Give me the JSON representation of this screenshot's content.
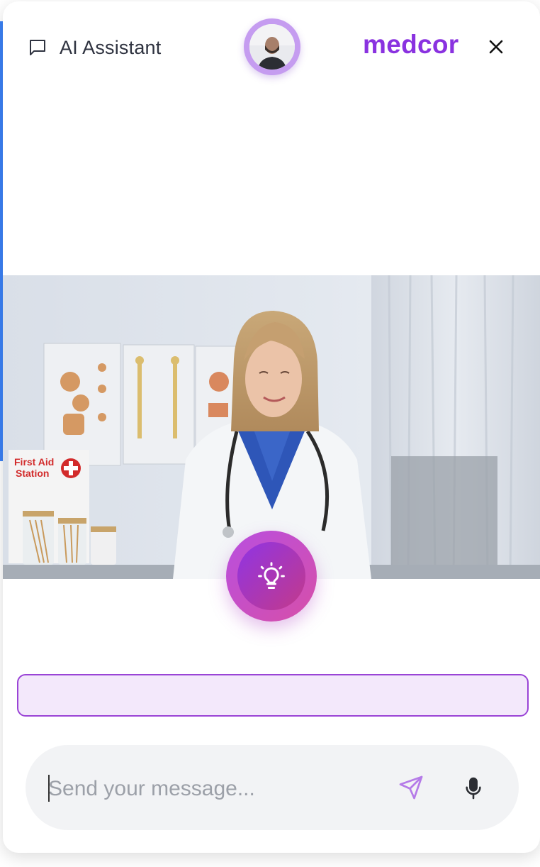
{
  "header": {
    "assistant_label": "AI Assistant",
    "brand": "medcor"
  },
  "video": {
    "poster_text": "First Aid\nStation"
  },
  "suggestion": {
    "text": ""
  },
  "composer": {
    "placeholder": "Send your message..."
  },
  "colors": {
    "brand": "#8a32e0",
    "accent_border": "#9a44d6",
    "suggestion_bg": "#f3e8fb",
    "hint_gradient_start": "#8f34e4",
    "hint_gradient_end": "#c33a8a",
    "composer_bg": "#f2f3f5"
  },
  "icons": {
    "chat": "message-square-icon",
    "close": "close-icon",
    "hint": "lightbulb-icon",
    "send": "send-icon",
    "mic": "microphone-icon"
  }
}
